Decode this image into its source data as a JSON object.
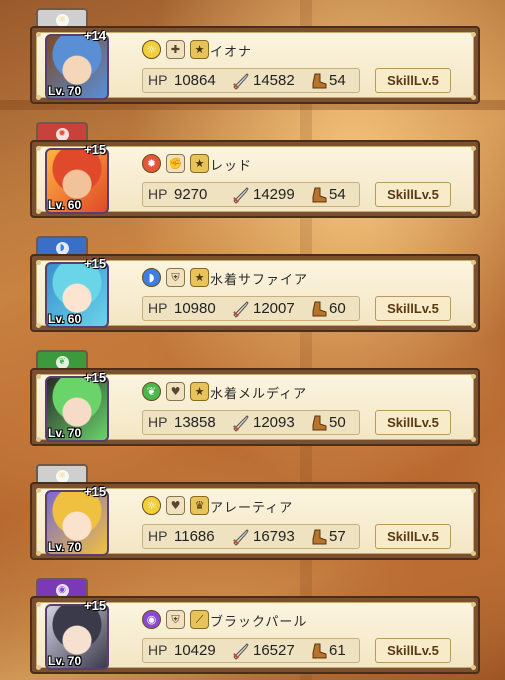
{
  "units": [
    {
      "element": "light",
      "tab_color": "#cfcfcf",
      "elem_color": "#f1cf3a",
      "elem_glyph": "☼",
      "plus": "+14",
      "level": "Lv. 70",
      "name": "イオナ",
      "hp_label": "HP",
      "hp": "10864",
      "atk": "14582",
      "spd": "54",
      "skill": "SkillLv.5",
      "icons": [
        "light-element-icon",
        "cross-role-icon",
        "star-rarity-icon"
      ],
      "portrait_colors": [
        "#5a8fd6",
        "#f6d6b8",
        "#7a4a2a"
      ]
    },
    {
      "element": "fire",
      "tab_color": "#c8413a",
      "elem_color": "#e4563a",
      "elem_glyph": "✹",
      "plus": "+15",
      "level": "Lv. 60",
      "name": "レッド",
      "hp_label": "HP",
      "hp": "9270",
      "atk": "14299",
      "spd": "54",
      "skill": "SkillLv.5",
      "icons": [
        "fire-element-icon",
        "fist-role-icon",
        "star-rarity-icon"
      ],
      "portrait_colors": [
        "#e04a2a",
        "#f2c29a",
        "#ffb340"
      ]
    },
    {
      "element": "water",
      "tab_color": "#3a6fc8",
      "elem_color": "#3c7fe0",
      "elem_glyph": "◗",
      "plus": "+15",
      "level": "Lv. 60",
      "name": "水着サファイア",
      "hp_label": "HP",
      "hp": "10980",
      "atk": "12007",
      "spd": "60",
      "skill": "SkillLv.5",
      "icons": [
        "water-element-icon",
        "shield-role-icon",
        "star-rarity-icon"
      ],
      "portrait_colors": [
        "#6ad4e8",
        "#fbe4d0",
        "#3a8fd0"
      ]
    },
    {
      "element": "wind",
      "tab_color": "#3c9a3c",
      "elem_color": "#4ab84a",
      "elem_glyph": "❦",
      "plus": "+15",
      "level": "Lv. 70",
      "name": "水着メルディア",
      "hp_label": "HP",
      "hp": "13858",
      "atk": "12093",
      "spd": "50",
      "skill": "SkillLv.5",
      "icons": [
        "wind-element-icon",
        "heart-role-icon",
        "star-rarity-icon"
      ],
      "portrait_colors": [
        "#6ad46a",
        "#f6dcc6",
        "#2a2a2a"
      ]
    },
    {
      "element": "light",
      "tab_color": "#cfcfcf",
      "elem_color": "#f1cf3a",
      "elem_glyph": "☼",
      "plus": "+15",
      "level": "Lv. 70",
      "name": "アレーティア",
      "hp_label": "HP",
      "hp": "11686",
      "atk": "16793",
      "spd": "57",
      "skill": "SkillLv.5",
      "icons": [
        "light-element-icon",
        "heart-role-icon",
        "crown-rarity-icon"
      ],
      "portrait_colors": [
        "#f0c040",
        "#fbe2cc",
        "#7a6ad0"
      ]
    },
    {
      "element": "dark",
      "tab_color": "#7a3ab8",
      "elem_color": "#8a4ad0",
      "elem_glyph": "◉",
      "plus": "+15",
      "level": "Lv. 70",
      "name": "ブラックパール",
      "hp_label": "HP",
      "hp": "10429",
      "atk": "16527",
      "spd": "61",
      "skill": "SkillLv.5",
      "icons": [
        "dark-element-icon",
        "shield-role-icon",
        "sword-rarity-icon"
      ],
      "portrait_colors": [
        "#3a3a4a",
        "#f6e0d0",
        "#d0d0e0"
      ]
    }
  ]
}
